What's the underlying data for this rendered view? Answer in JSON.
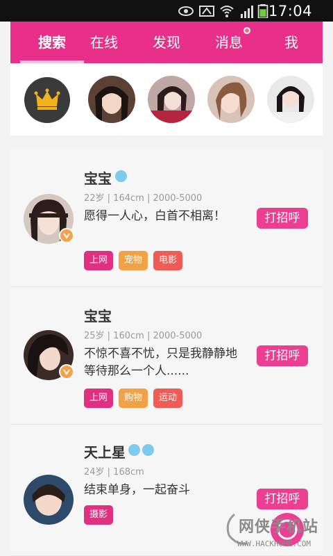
{
  "status_bar": {
    "time": "17:04"
  },
  "tabs": [
    {
      "label": "搜索"
    },
    {
      "label": "在线"
    },
    {
      "label": "发现"
    },
    {
      "label": "消息"
    },
    {
      "label": "我"
    }
  ],
  "colors": {
    "brand": "#e8308a",
    "button": "#ec3f91",
    "tag_pink": "#e0307f",
    "tag_orange": "#f2a246",
    "tag_red": "#f15b56"
  },
  "users": [
    {
      "name": "宝宝",
      "meta": "22岁 | 164cm | 2000-5000",
      "bio": "愿得一人心，白首不相离！",
      "tags": [
        "上网",
        "宠物",
        "电影"
      ],
      "action": "打招呼"
    },
    {
      "name": "宝宝",
      "meta": "25岁 | 160cm | 2000-5000",
      "bio": "不惊不喜不忧，只是我静静地等待那么一个人......",
      "tags": [
        "上网",
        "购物",
        "运动"
      ],
      "action": "打招呼"
    },
    {
      "name": "天上星",
      "meta": "24岁 | 168cm",
      "bio": "结束单身，一起奋斗",
      "tags": [
        "摄影"
      ],
      "action": "打招呼"
    }
  ],
  "watermark": {
    "title": "网侠手机站",
    "url": "WWW.HACKHOME.COM"
  }
}
